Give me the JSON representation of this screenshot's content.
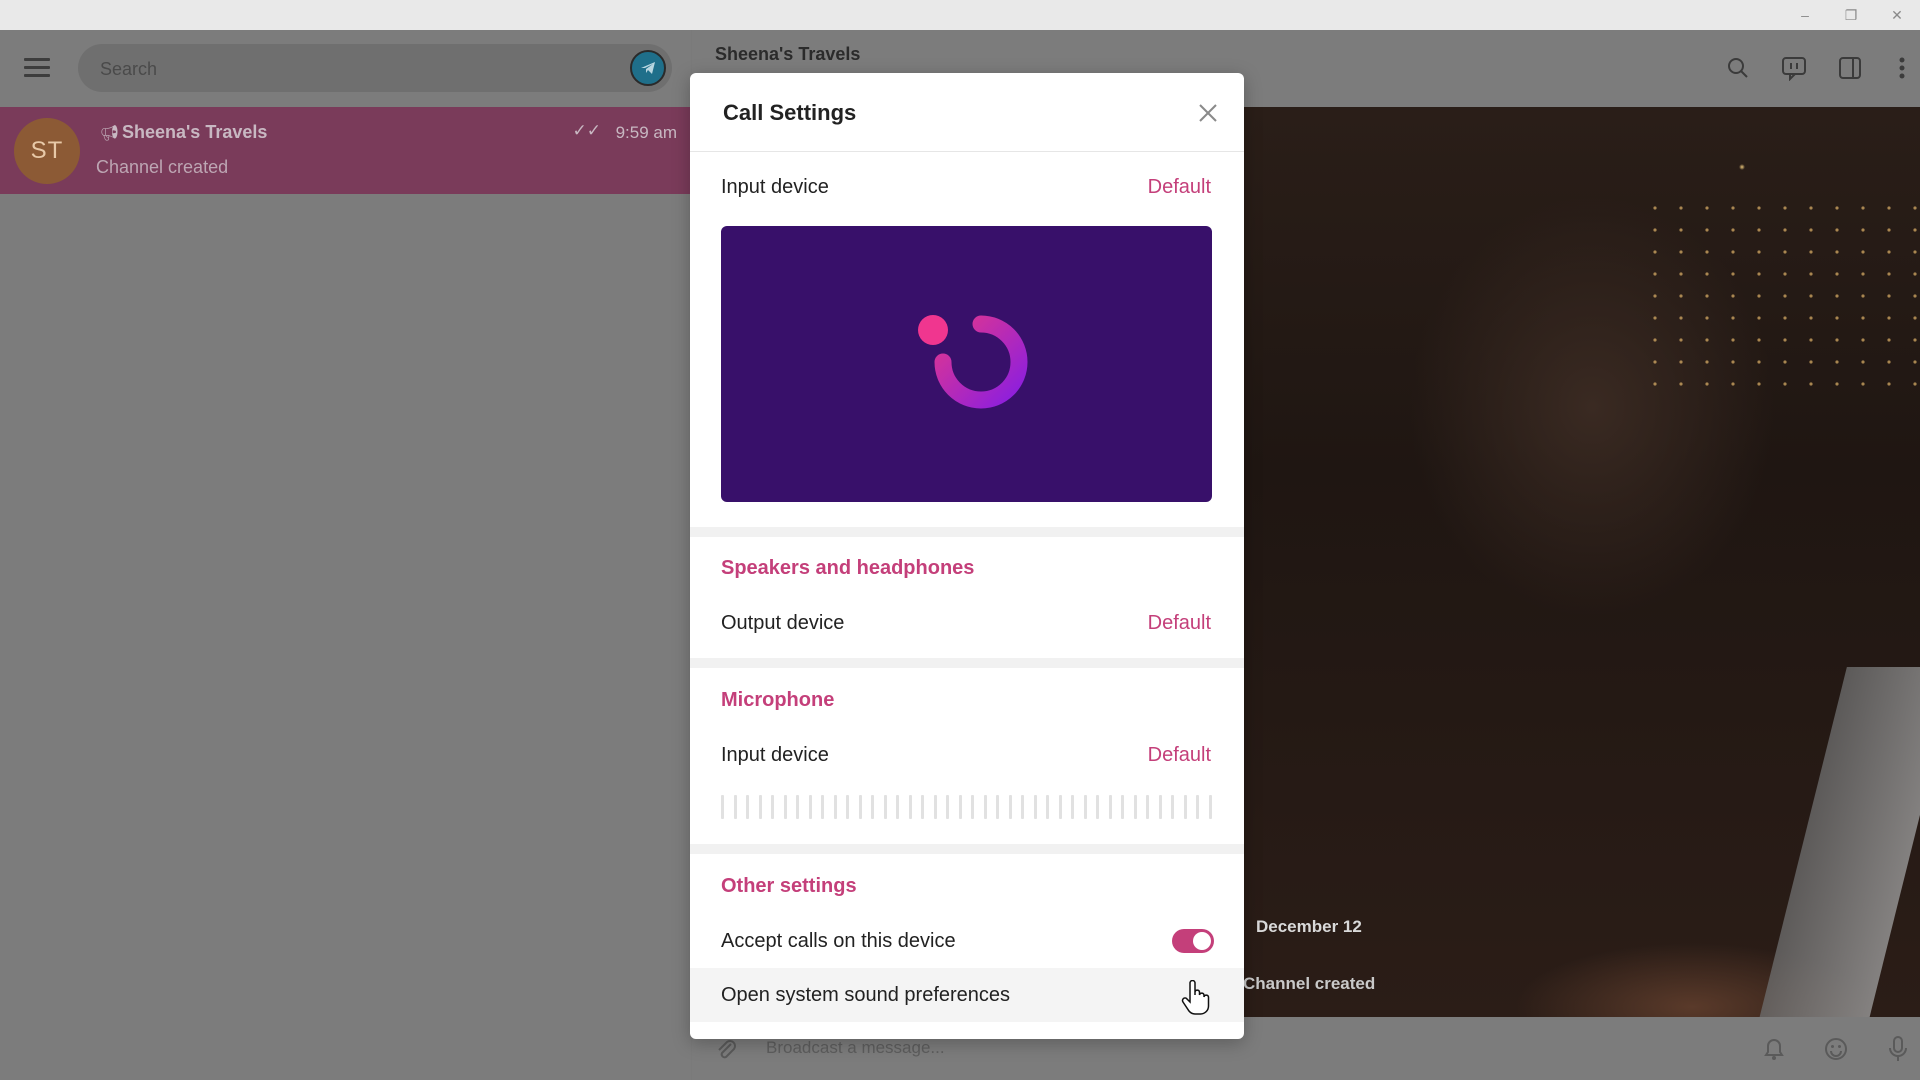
{
  "window": {
    "minimize_glyph": "–",
    "restore_glyph": "❐",
    "close_glyph": "✕"
  },
  "sidebar": {
    "search_placeholder": "Search",
    "chats": [
      {
        "avatar_initials": "ST",
        "name": "Sheena's Travels",
        "time": "9:59 am",
        "preview": "Channel created",
        "type_icon": "megaphone-icon",
        "status_icon": "double-check-icon"
      }
    ]
  },
  "chat": {
    "title": "Sheena's Travels",
    "header_icons": [
      "search-icon",
      "video-chat-icon",
      "sidebar-toggle-icon",
      "more-vertical-icon"
    ],
    "date_label": "December 12",
    "service_message": "Channel created",
    "composer_placeholder": "Broadcast a message...",
    "composer_icons": [
      "attach-icon",
      "bell-icon",
      "emoji-icon",
      "microphone-icon"
    ]
  },
  "dialog": {
    "title": "Call Settings",
    "camera_section": {
      "label": "Input device",
      "value": "Default"
    },
    "speakers_section": {
      "title": "Speakers and headphones",
      "label": "Output device",
      "value": "Default"
    },
    "microphone_section": {
      "title": "Microphone",
      "label": "Input device",
      "value": "Default",
      "level": 0
    },
    "other_section": {
      "title": "Other settings",
      "accept_calls_label": "Accept calls on this device",
      "accept_calls_enabled": true,
      "sound_prefs_label": "Open system sound preferences"
    }
  },
  "colors": {
    "accent": "#c43f7a",
    "camera_bg": "#38106a",
    "selected_chat": "#7a3b5a"
  }
}
